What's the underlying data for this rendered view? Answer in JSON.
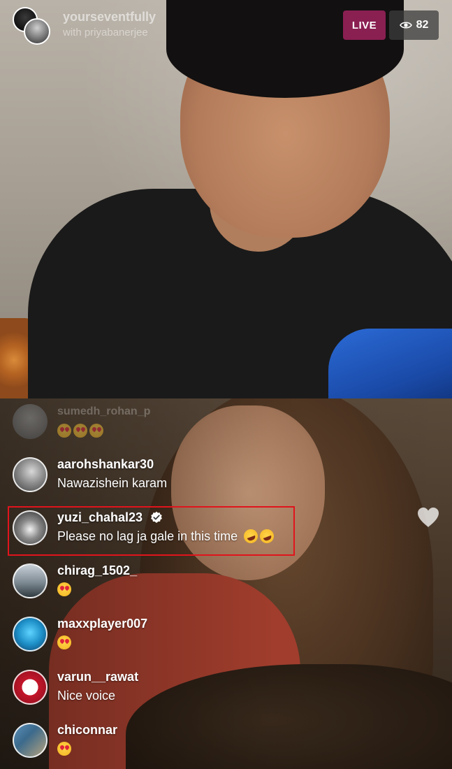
{
  "header": {
    "host_name": "yourseventfully",
    "host_subtitle": "with priyabanerjee",
    "live_label": "LIVE",
    "viewer_count": "82"
  },
  "faded_comment": {
    "username": "sumedh_rohan_p",
    "text": "😍😍😍"
  },
  "comments": [
    {
      "username": "aarohshankar30",
      "text": "Nawazishein karam",
      "verified": false
    },
    {
      "username": "yuzi_chahal23",
      "text": "Please no lag ja gale in this time",
      "verified": true,
      "emojis": [
        "rofl",
        "rofl"
      ],
      "highlighted": true
    },
    {
      "username": "chirag_1502_",
      "text": "",
      "emojis": [
        "heart-eyes"
      ]
    },
    {
      "username": "maxxplayer007",
      "text": "",
      "emojis": [
        "heart-eyes"
      ]
    },
    {
      "username": "varun__rawat",
      "text": "Nice voice"
    },
    {
      "username": "chiconnar",
      "text": "",
      "emojis": [
        "heart-eyes"
      ]
    }
  ],
  "colors": {
    "live_badge": "#8a1f52",
    "highlight_border": "#e0141c",
    "viewer_badge": "rgba(60,60,60,0.75)"
  }
}
